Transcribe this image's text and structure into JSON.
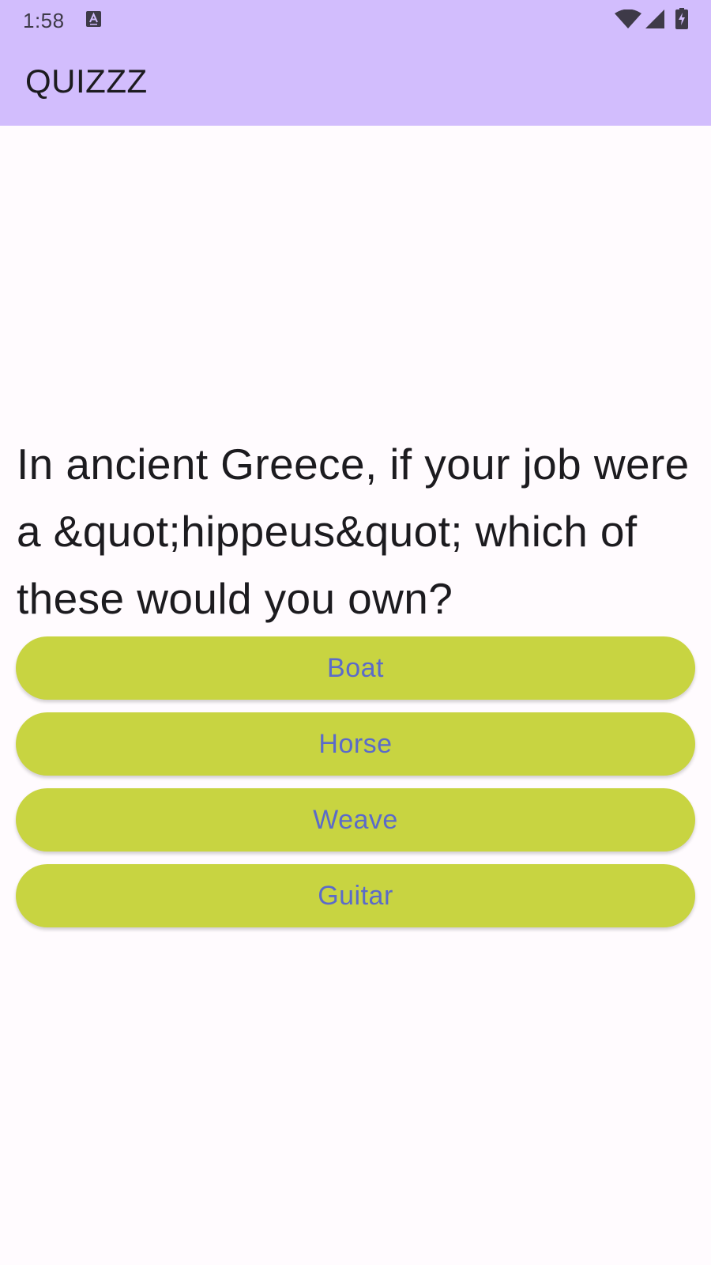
{
  "status_bar": {
    "time": "1:58",
    "icons": [
      "notification-a-icon",
      "wifi-icon",
      "cellular-signal-icon",
      "battery-charging-icon"
    ]
  },
  "app_bar": {
    "title": "QUIZZZ",
    "background_color": "#d2bdfd"
  },
  "question": {
    "text": "In ancient Greece, if your job were a &quot;hippeus&quot; which of these would you own?"
  },
  "answers": [
    {
      "label": "Boat"
    },
    {
      "label": "Horse"
    },
    {
      "label": "Weave"
    },
    {
      "label": "Guitar"
    }
  ],
  "colors": {
    "answer_background": "#c8d441",
    "answer_text": "#5b6bc9"
  }
}
